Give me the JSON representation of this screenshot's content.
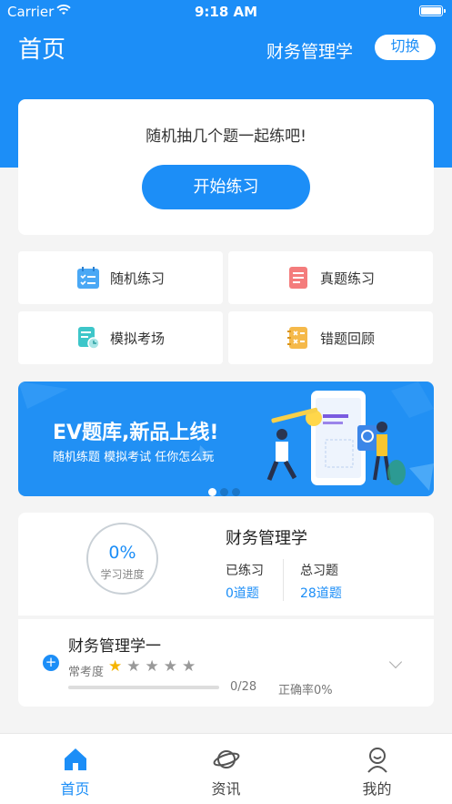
{
  "status_bar": {
    "carrier": "Carrier",
    "time": "9:18 AM"
  },
  "header": {
    "title": "首页",
    "subject": "财务管理学",
    "switch_label": "切换"
  },
  "practice_card": {
    "prompt": "随机抽几个题一起练吧!",
    "start_label": "开始练习"
  },
  "features": [
    {
      "label": "随机练习",
      "icon": "calendar-checklist-icon",
      "color": "#4aa8f5"
    },
    {
      "label": "真题练习",
      "icon": "document-icon",
      "color": "#f47c7c"
    },
    {
      "label": "模拟考场",
      "icon": "clock-document-icon",
      "color": "#3dc6c9"
    },
    {
      "label": "错题回顾",
      "icon": "error-notebook-icon",
      "color": "#f5b94a"
    }
  ],
  "banner": {
    "title": "EV题库,新品上线!",
    "subtitle": "随机练题 模拟考试 任你怎么玩",
    "active_dot": 0,
    "dot_count": 3
  },
  "progress": {
    "percent": "0%",
    "label": "学习进度",
    "subject": "财务管理学",
    "practiced_label": "已练习",
    "practiced_value": "0道题",
    "total_label": "总习题",
    "total_value": "28道题"
  },
  "chapter": {
    "title": "财务管理学一",
    "frequency_label": "常考度",
    "rating": 1,
    "rating_max": 5,
    "count": "0/28",
    "accuracy": "正确率0%",
    "progress_fraction": 0
  },
  "tabbar": {
    "items": [
      {
        "label": "首页",
        "icon": "home-icon",
        "active": true
      },
      {
        "label": "资讯",
        "icon": "planet-icon",
        "active": false
      },
      {
        "label": "我的",
        "icon": "person-icon",
        "active": false
      }
    ]
  },
  "colors": {
    "primary": "#1c8ef7",
    "star": "#f5b400"
  }
}
